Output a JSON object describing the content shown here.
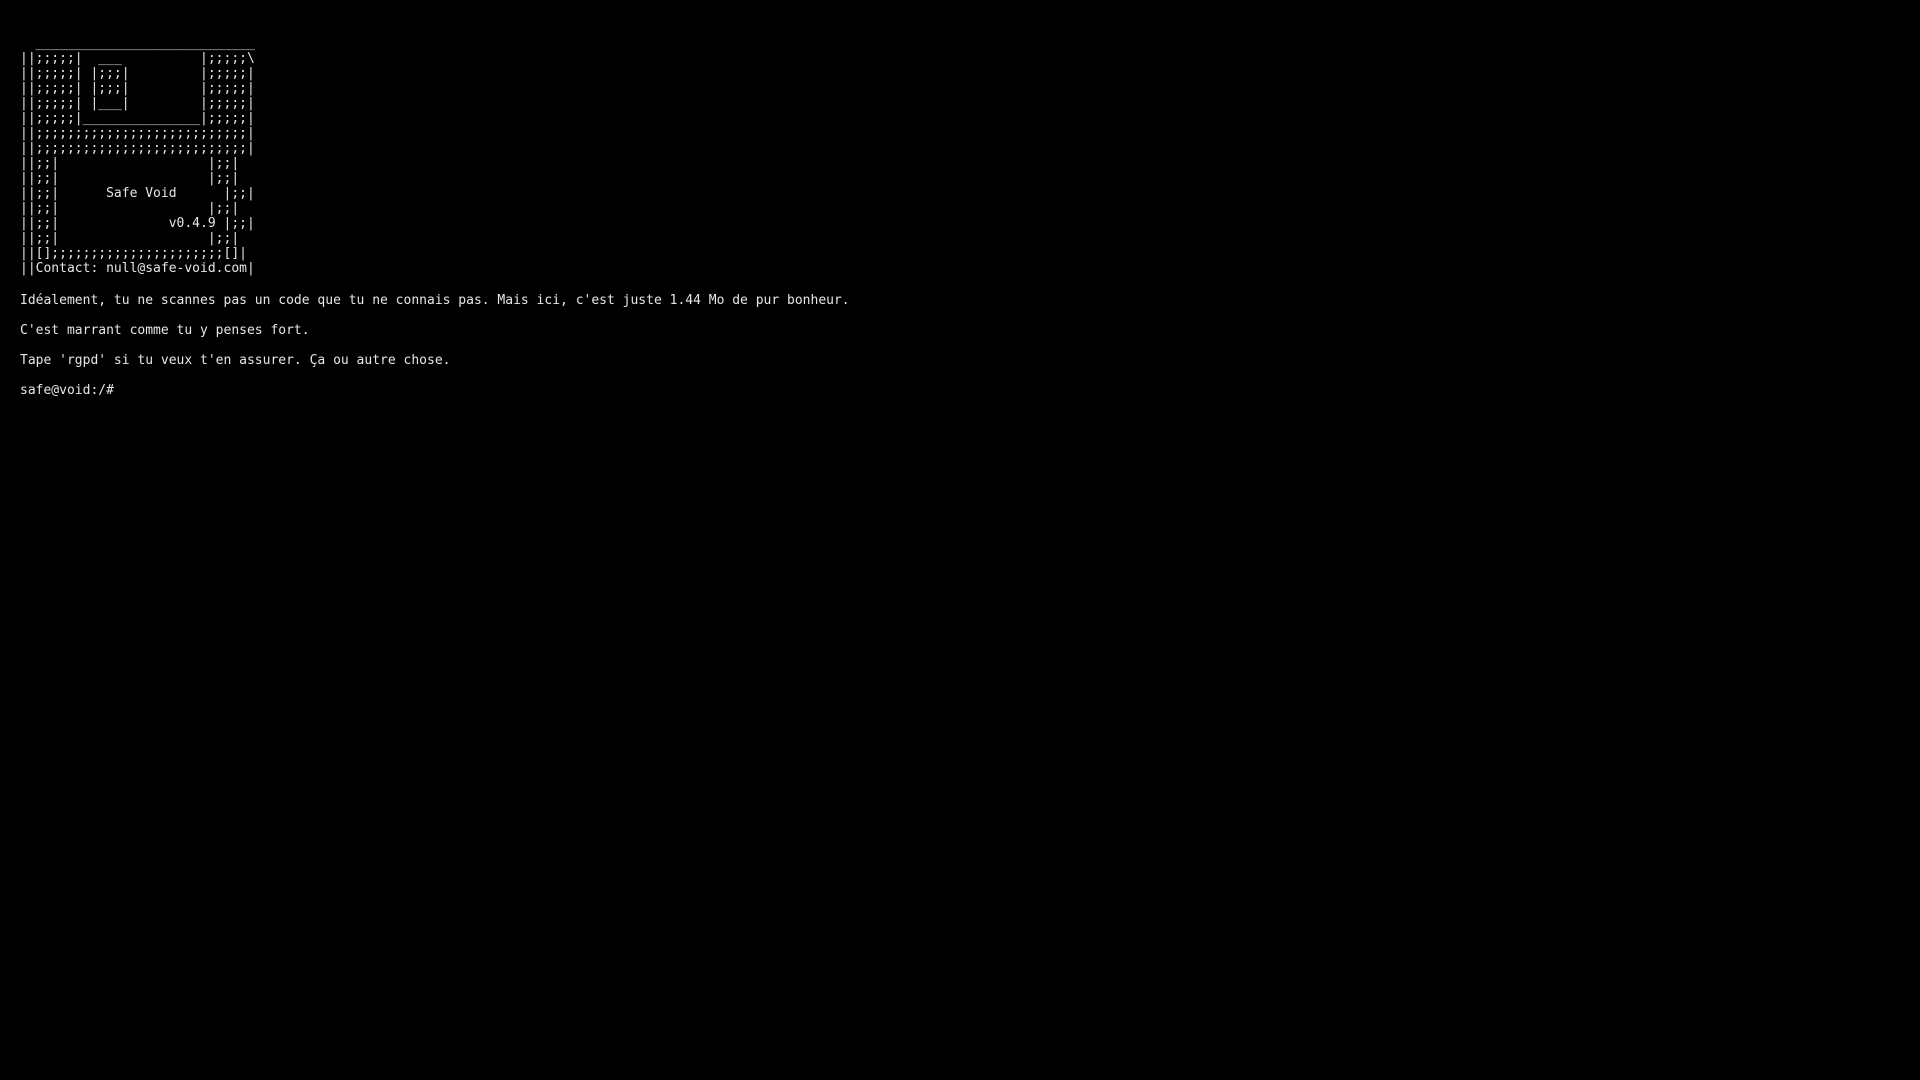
{
  "banner": {
    "lines": [
      "  ____________________________",
      "||;;;;;|  ___          |;;;;;\\",
      "||;;;;;| |;;;|         |;;;;;|",
      "||;;;;;| |;;;|         |;;;;;|",
      "||;;;;;| |___|         |;;;;;|",
      "||;;;;;|_______________|;;;;;|",
      "||;;;;;;;;;;;;;;;;;;;;;;;;;;;|",
      "||;;;;;;;;;;;;;;;;;;;;;;;;;;;|",
      "||;;|                   |;;|",
      "||;;|                   |;;|",
      "||;;|      Safe Void      |;;|",
      "||;;|                   |;;|",
      "||;;|              v0.4.9 |;;|",
      "||;;|                   |;;|",
      "||[];;;;;;;;;;;;;;;;;;;;;;[]|",
      "||Contact: null@safe-void.com|"
    ]
  },
  "messages": [
    "Idéalement, tu ne scannes pas un code que tu ne connais pas. Mais ici, c'est juste 1.44 Mo de pur bonheur.",
    "C'est marrant comme tu y penses fort.",
    "Tape 'rgpd' si tu veux t'en assurer. Ça ou autre chose."
  ],
  "prompt": {
    "text": "safe@void:/#",
    "value": ""
  },
  "colors": {
    "background": "#000000",
    "text": "#e6e6e6"
  }
}
